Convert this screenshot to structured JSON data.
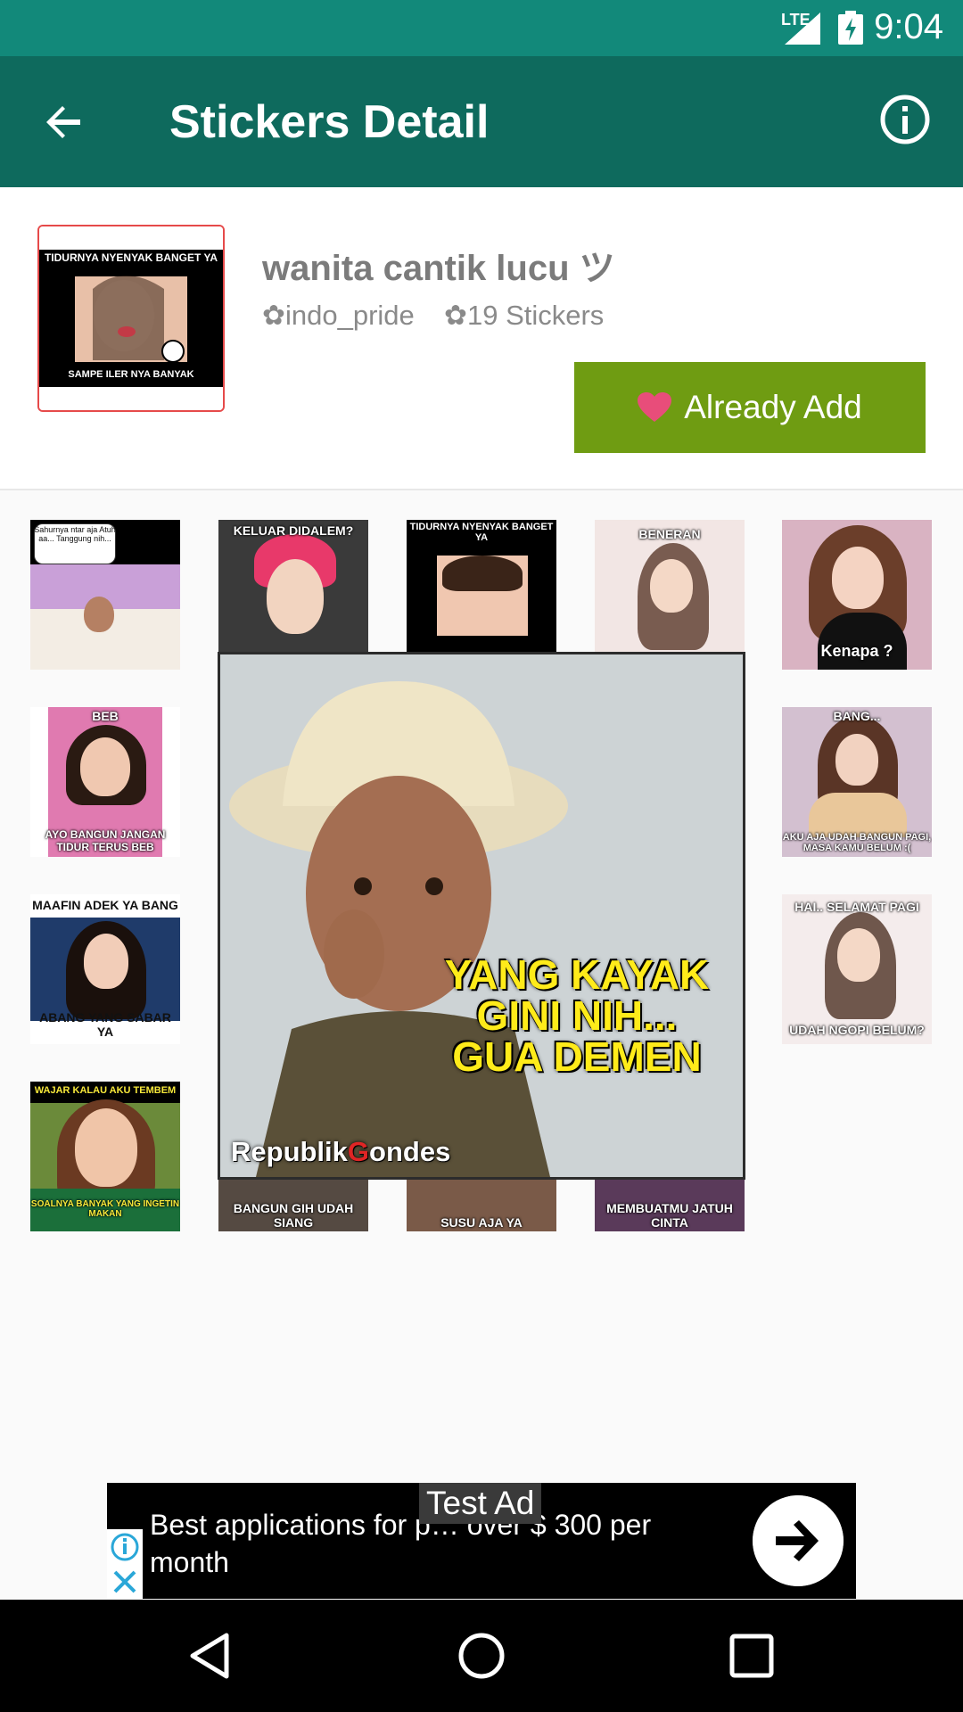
{
  "status_bar": {
    "time": "9:04",
    "network": "LTE",
    "icons": [
      "signal-icon",
      "battery-icon"
    ]
  },
  "toolbar": {
    "title": "Stickers Detail",
    "back_icon": "arrow-back-icon",
    "info_icon": "info-icon"
  },
  "pack": {
    "name": "wanita cantik lucu ツ",
    "publisher": "✿indo_pride",
    "count": "✿19 Stickers",
    "add_button_label": "Already Add",
    "tray_captions": [
      "TIDURNYA NYENYAK BANGET YA",
      "SAMPE ILER NYA BANYAK"
    ]
  },
  "stickers": [
    {
      "top": "Sahurnya ntar aja Atuh aa... Tanggung nih...",
      "bottom": ""
    },
    {
      "top": "KELUAR DIDALEM?",
      "bottom": ""
    },
    {
      "top": "TIDURNYA NYENYAK BANGET YA",
      "bottom": ""
    },
    {
      "top": "BENERAN",
      "bottom": ""
    },
    {
      "top": "",
      "bottom": "Kenapa ?"
    },
    {
      "top": "BEB",
      "bottom": "AYO BANGUN JANGAN TIDUR TERUS BEB"
    },
    {
      "top": "BANG...",
      "bottom": "AKU AJA UDAH BANGUN PAGI, MASA KAMU BELUM :("
    },
    {
      "top": "MAAFIN ADEK YA BANG",
      "bottom": "ABANG YANG SABAR YA"
    },
    {
      "top": "HAI.. SELAMAT PAGI",
      "bottom": "UDAH NGOPI BELUM?"
    },
    {
      "top": "WAJAR KALAU AKU TEMBEM",
      "bottom": "SOALNYA BANYAK YANG INGETIN MAKAN"
    },
    {
      "top": "",
      "bottom": "BANGUN GIH UDAH SIANG"
    },
    {
      "top": "",
      "bottom": "SUSU AJA YA"
    },
    {
      "top": "",
      "bottom": "MEMBUATMU JATUH CINTA"
    }
  ],
  "preview": {
    "caption_lines": [
      "YANG KAYAK",
      "GINI NIH...",
      "GUA DEMEN"
    ],
    "brand_prefix": "Republik",
    "brand_g": "G",
    "brand_suffix": "ondes"
  },
  "ad": {
    "test_label": "Test Ad",
    "text": "Best applications for p… over $ 300 per month",
    "icons": [
      "adchoices-info-icon",
      "ad-close-icon",
      "arrow-forward-icon"
    ]
  },
  "nav": {
    "icons": [
      "nav-back-icon",
      "nav-home-icon",
      "nav-recents-icon"
    ]
  },
  "colors": {
    "status": "#12897a",
    "toolbar": "#0e6a5d",
    "button": "#6f9c12",
    "heart": "#e84d7a",
    "caption_yellow": "#ffeb1a"
  }
}
